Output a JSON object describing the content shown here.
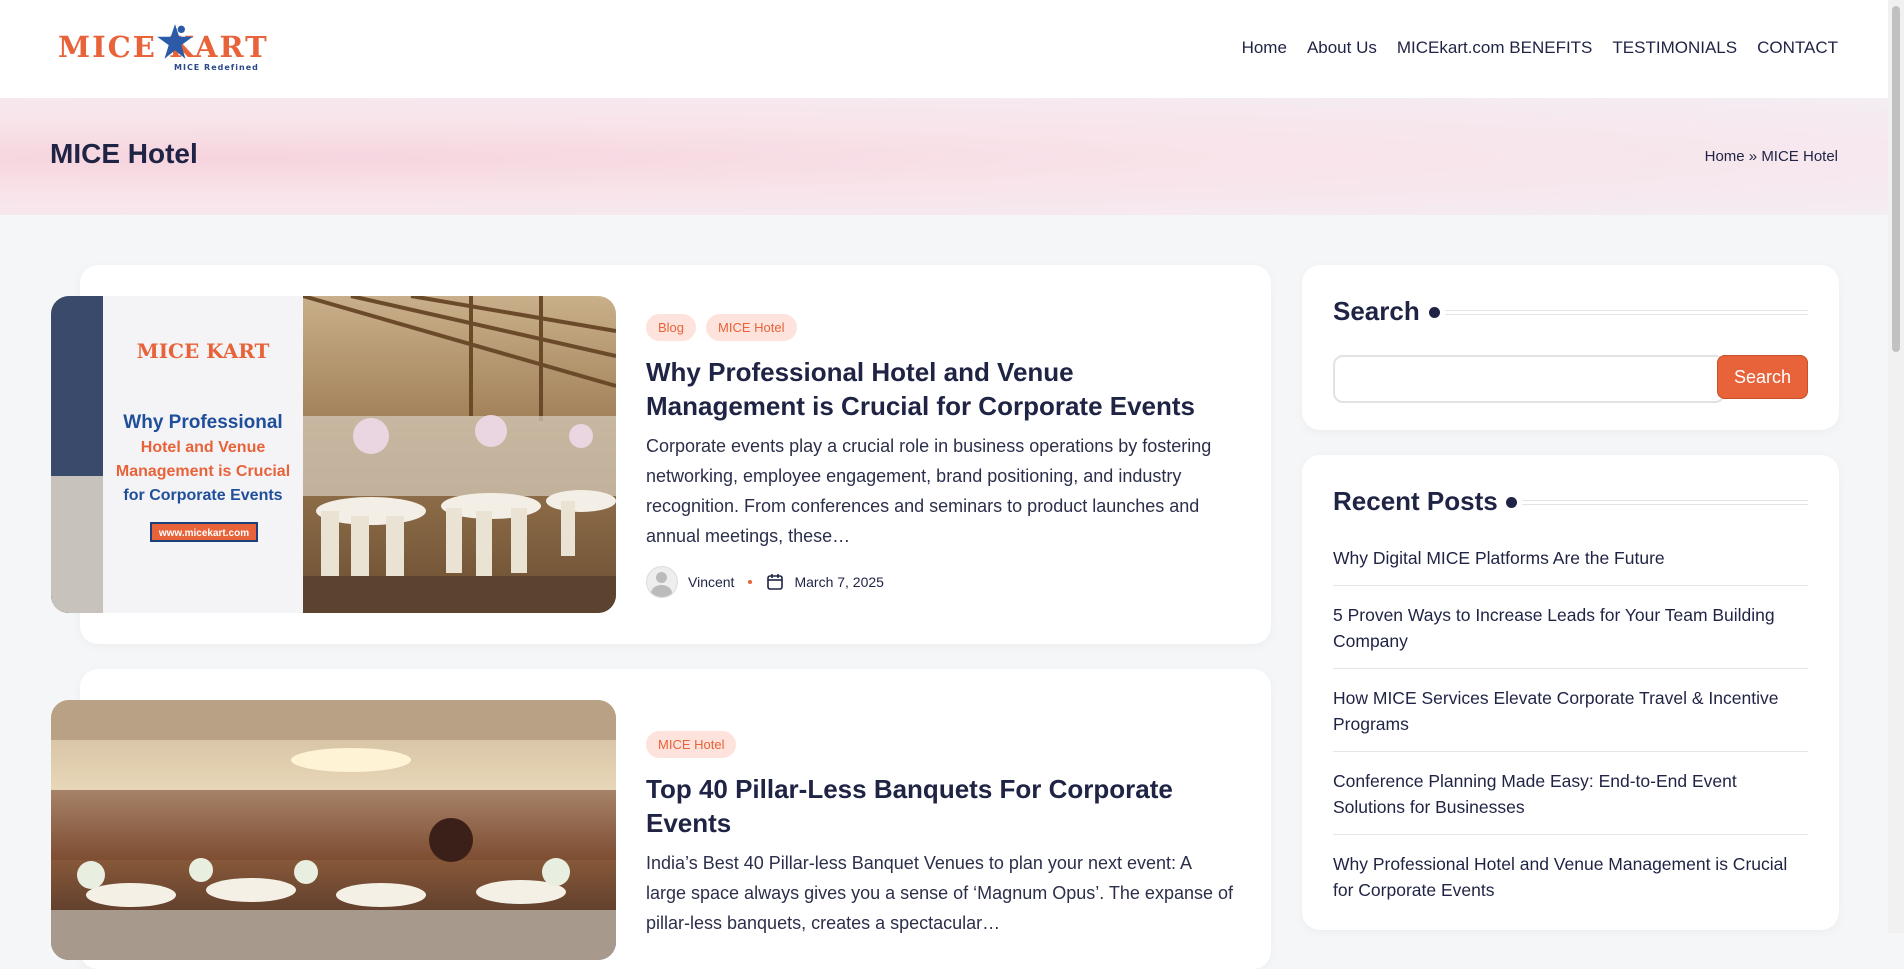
{
  "header": {
    "logo_text": "MICE KART",
    "logo_tagline": "MICE Redefined",
    "nav": [
      "Home",
      "About Us",
      "MICEkart.com BENEFITS",
      "TESTIMONIALS",
      "CONTACT"
    ]
  },
  "banner": {
    "title": "MICE Hotel",
    "breadcrumb_home": "Home",
    "breadcrumb_sep": "»",
    "breadcrumb_current": "MICE Hotel"
  },
  "posts": [
    {
      "tags": [
        "Blog",
        "MICE Hotel"
      ],
      "title": "Why Professional Hotel and Venue Management is Crucial for Corporate Events",
      "excerpt": "Corporate events play a crucial role in business operations by fostering networking, employee engagement, brand positioning, and industry recognition. From conferences and seminars to product launches and annual meetings, these…",
      "author": "Vincent",
      "date": "March 7, 2025",
      "thumb": {
        "logo": "MICE KART",
        "line1": "Why Professional",
        "line2": "Hotel and Venue",
        "line3": "Management is Crucial",
        "line4": "for Corporate Events",
        "url": "www.micekart.com"
      }
    },
    {
      "tags": [
        "MICE Hotel"
      ],
      "title": "Top 40 Pillar-Less Banquets For Corporate Events",
      "excerpt": "India’s Best 40 Pillar-less Banquet Venues to plan your next event: A large space always gives you a sense of ‘Magnum Opus’. The expanse of pillar-less banquets, creates a spectacular…"
    }
  ],
  "sidebar": {
    "search_title": "Search",
    "search_placeholder": "",
    "search_button": "Search",
    "recent_title": "Recent Posts",
    "recent_posts": [
      "Why Digital MICE Platforms Are the Future",
      "5 Proven Ways to Increase Leads for Your Team Building Company",
      "How MICE Services Elevate Corporate Travel & Incentive Programs",
      "Conference Planning Made Easy: End-to-End Event Solutions for Businesses",
      "Why Professional Hotel and Venue Management is Crucial for Corporate Events"
    ]
  },
  "colors": {
    "accent": "#e8633a",
    "navy": "#1f2344",
    "tag_bg": "#fde3dc"
  }
}
